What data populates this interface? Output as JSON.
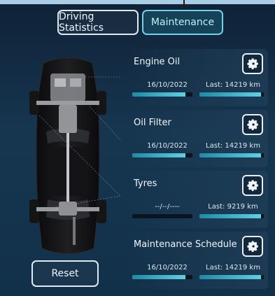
{
  "tabs": {
    "driving_statistics": "Driving Statistics",
    "maintenance": "Maintenance"
  },
  "reset_label": "Reset",
  "items": [
    {
      "title": "Engine Oil",
      "date": "16/10/2022",
      "last": "Last: 14219  km",
      "date_progress": 0.88,
      "distance_progress": 0.96
    },
    {
      "title": "Oil Filter",
      "date": "16/10/2022",
      "last": "Last: 14219  km",
      "date_progress": 0.88,
      "distance_progress": 0.96
    },
    {
      "title": "Tyres",
      "date": "--/--/----",
      "last": "Last: 9219  km",
      "date_progress": 0.0,
      "distance_progress": 0.96
    },
    {
      "title": "Maintenance Schedule",
      "date": "16/10/2022",
      "last": "Last: 14219  km",
      "date_progress": 0.88,
      "distance_progress": 0.96
    }
  ],
  "colors": {
    "accent": "#5fd0e4",
    "active_tab_border": "#6fd3e7",
    "background": "#163650"
  },
  "icons": {
    "settings": "gear-icon"
  }
}
